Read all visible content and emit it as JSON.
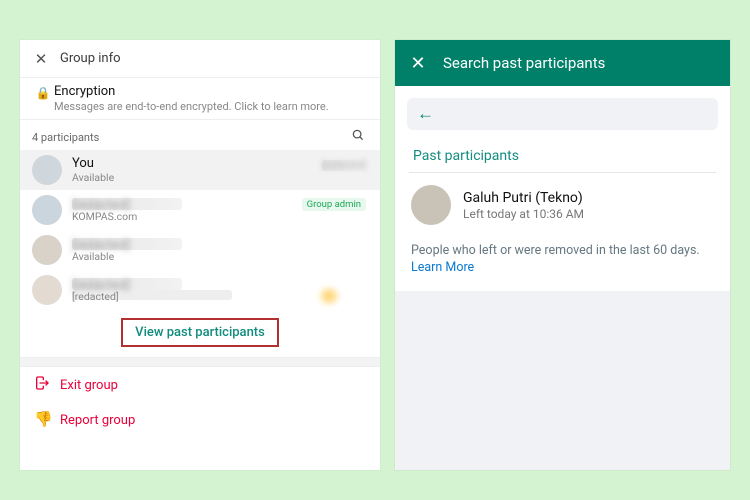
{
  "left": {
    "header": {
      "title": "Group info"
    },
    "encryption": {
      "title": "Encryption",
      "subtitle": "Messages are end-to-end encrypted. Click to learn more."
    },
    "participants_label": "4 participants",
    "participants": [
      {
        "name": "You",
        "meta": "Available",
        "right": "[redacted]",
        "selected": true,
        "name_blur": false,
        "right_blur": true,
        "admin": false
      },
      {
        "name": "[redacted]",
        "meta": "KOMPAS.com",
        "right": "",
        "selected": false,
        "name_blur": true,
        "right_blur": false,
        "admin": true
      },
      {
        "name": "[redacted]",
        "meta": "Available",
        "right": "",
        "selected": false,
        "name_blur": true,
        "right_blur": false,
        "admin": false
      },
      {
        "name": "[redacted]",
        "meta": "[redacted]",
        "right": "",
        "selected": false,
        "name_blur": true,
        "right_blur": false,
        "admin": false,
        "meta_blur": true
      }
    ],
    "admin_badge": "Group admin",
    "view_past": "View past participants",
    "actions": {
      "exit": "Exit group",
      "report": "Report group"
    }
  },
  "right": {
    "header": {
      "title": "Search past participants"
    },
    "section_label": "Past participants",
    "entry": {
      "name": "Galuh Putri (Tekno)",
      "sub": "Left today at 10:36 AM"
    },
    "info_prefix": "People who left or were removed in the last 60 days. ",
    "info_link": "Learn More"
  }
}
